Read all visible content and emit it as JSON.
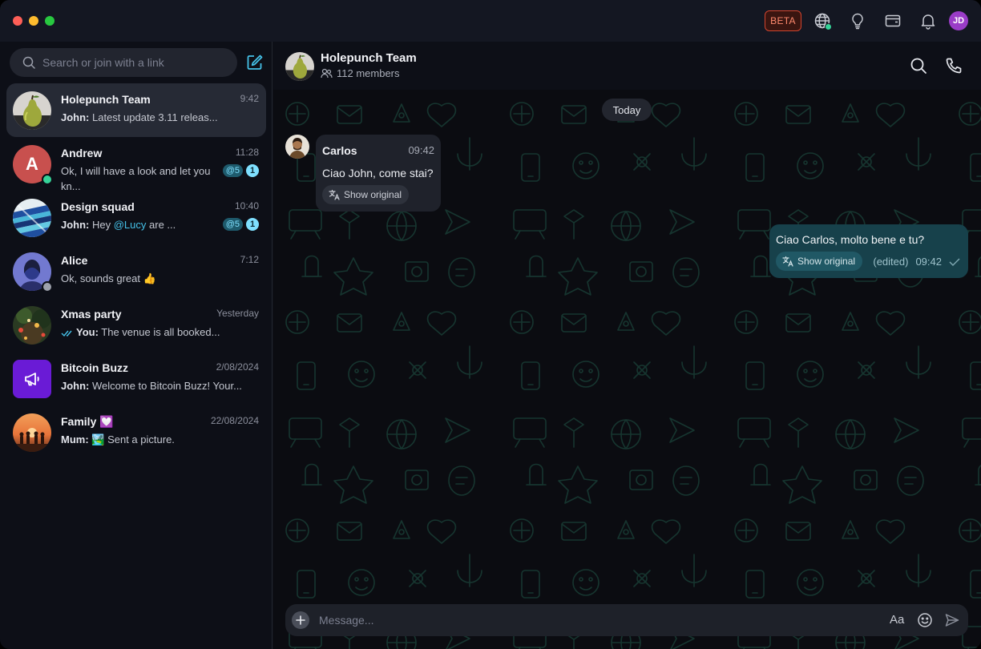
{
  "titlebar": {
    "beta_label": "BETA",
    "user_initials": "JD",
    "colors": {
      "beta_border": "#d2442e",
      "avatar_bg": "#9a3cc7",
      "online": "#36d399"
    }
  },
  "search": {
    "placeholder": "Search or join with a link"
  },
  "chats": [
    {
      "name": "Holepunch Team",
      "time": "9:42",
      "sender": "John:",
      "preview": " Latest update 3.11 releas...",
      "active": true
    },
    {
      "name": "Andrew",
      "initial": "A",
      "time": "11:28",
      "preview": "Ok, I will have a look and let you kn...",
      "mentions": "5",
      "unread": "1",
      "status": "online"
    },
    {
      "name": "Design squad",
      "time": "10:40",
      "sender": "John:",
      "preview_pre": " Hey ",
      "mention": "@Lucy",
      "preview_post": " are ...",
      "mentions": "5",
      "unread": "1"
    },
    {
      "name": "Alice",
      "time": "7:12",
      "preview": "Ok, sounds great 👍",
      "status": "away"
    },
    {
      "name": "Xmas party",
      "time": "Yesterday",
      "sender": "You:",
      "preview": " The venue is all booked..."
    },
    {
      "name": "Bitcoin Buzz",
      "time": "2/08/2024",
      "sender": "John:",
      "preview": " Welcome to Bitcoin Buzz! Your..."
    },
    {
      "name": "Family",
      "emoji": "💟",
      "time": "22/08/2024",
      "sender": "Mum:",
      "preview": " 🏞️ Sent a picture."
    }
  ],
  "conversation": {
    "title": "Holepunch Team",
    "members": "112 members",
    "date_divider": "Today",
    "incoming": {
      "sender": "Carlos",
      "time": "09:42",
      "text": "Ciao John, come stai?",
      "action": "Show original"
    },
    "outgoing": {
      "text": "Ciao Carlos, molto bene e tu?",
      "action": "Show original",
      "edited": "(edited)",
      "time": "09:42"
    }
  },
  "composer": {
    "placeholder": "Message...",
    "format_label": "Aa"
  }
}
